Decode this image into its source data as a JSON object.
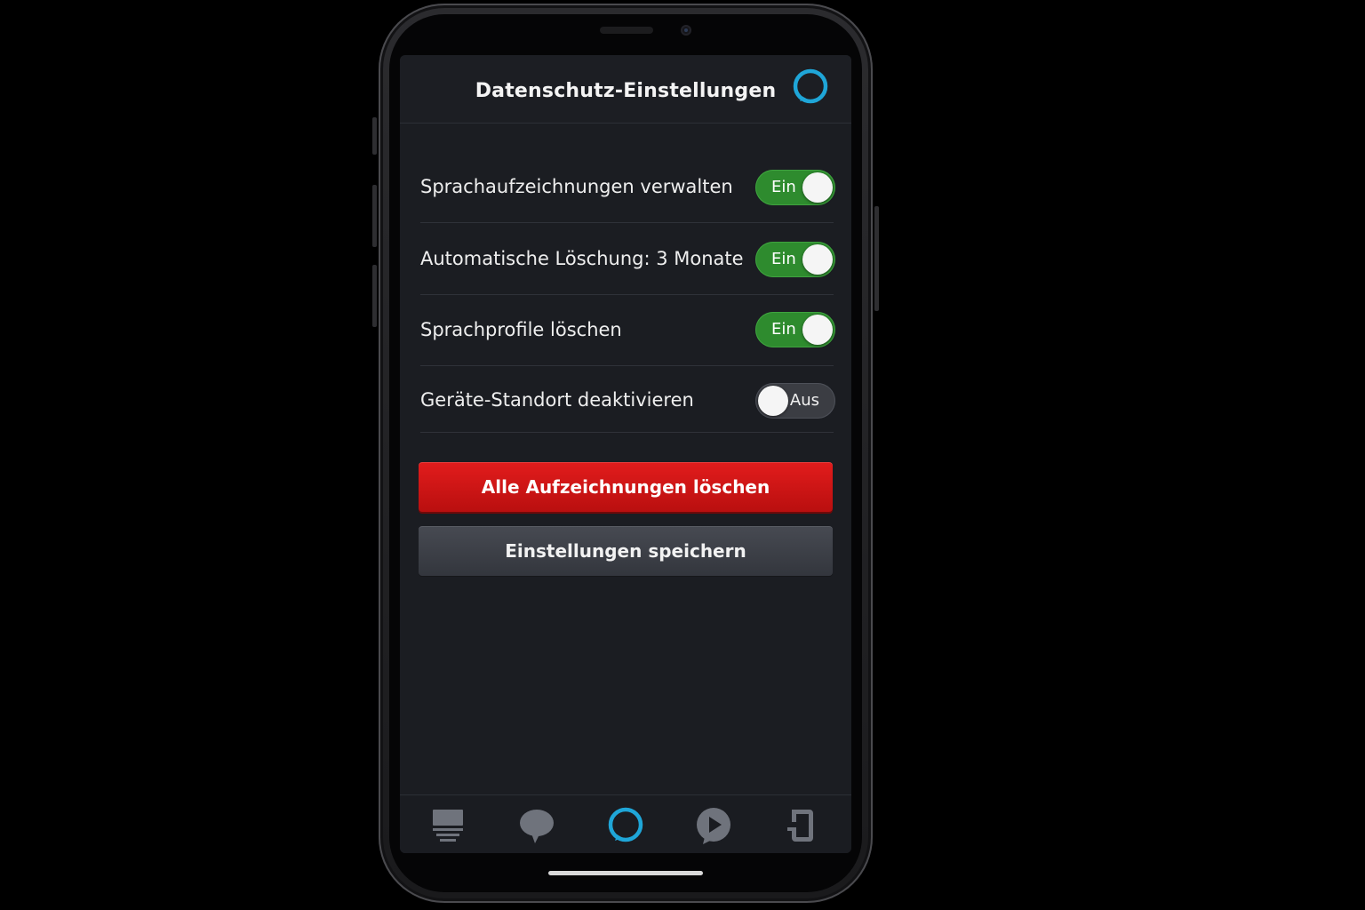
{
  "header": {
    "title": "Datenschutz-Einstellungen",
    "alexa_icon": "alexa-ring-icon"
  },
  "settings": [
    {
      "label": "Sprachaufzeichnungen verwalten",
      "state": "on",
      "toggle_text": "Ein"
    },
    {
      "label": "Automatische Löschung: 3 Monate",
      "state": "on",
      "toggle_text": "Ein"
    },
    {
      "label": "Sprachprofile löschen",
      "state": "on",
      "toggle_text": "Ein"
    },
    {
      "label": "Geräte-Standort deaktivieren",
      "state": "off",
      "toggle_text": "Aus"
    }
  ],
  "actions": {
    "delete_label": "Alle Aufzeichnungen löschen",
    "save_label": "Einstellungen speichern"
  },
  "bottom_nav": [
    {
      "icon": "home-icon",
      "active": false
    },
    {
      "icon": "communicate-icon",
      "active": false
    },
    {
      "icon": "alexa-icon",
      "active": true
    },
    {
      "icon": "play-icon",
      "active": false
    },
    {
      "icon": "devices-icon",
      "active": false
    }
  ],
  "colors": {
    "background": "#1b1d22",
    "toggle_on": "#2e8b2e",
    "toggle_off": "#3b3d43",
    "delete_button": "#d41616",
    "save_button": "#3d4048",
    "alexa_accent": "#1fa6d8",
    "nav_icon": "#6f737c"
  }
}
